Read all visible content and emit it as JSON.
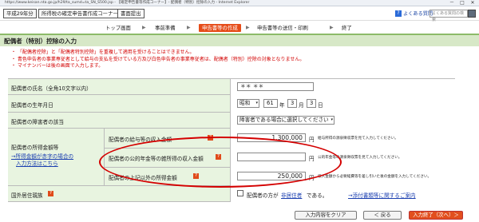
{
  "browser": {
    "title_text": "https://www.keisan.nta.go.jp/h29/ta_sumd=ta_SN_S500.jsp - 【確定申告書等作成コーナー】- 配偶者（特別）控除の入力 - Internet Explorer",
    "minimize": "－",
    "maximize": "□",
    "close": "✕"
  },
  "header": {
    "year_badge": "平成29年分",
    "corner_name": "所得税の確定申告書作成コーナー",
    "submit_label": "書面提出",
    "faq_label": "よくある質問",
    "search_placeholder": "よくある質問の検索"
  },
  "steps": [
    {
      "label": "トップ画面"
    },
    {
      "label": "事前準備"
    },
    {
      "label": "申告書等の作成"
    },
    {
      "label": "申告書等の送信・印刷"
    },
    {
      "label": "終了"
    }
  ],
  "section_title": "配偶者（特別）控除の入力",
  "cautions": [
    "・ 「配偶者控除」と「配偶者特別控除」を重複して適用を受けることはできません。",
    "・ 青色申告者の事業専従者として給与の支払を受けている方及び白色申告者の事業専従者は、配偶者（特別）控除の対象となりません。",
    "・ マイナンバーは後の画面で入力します。"
  ],
  "form": {
    "name_label": "配偶者の氏名（全角10文字以内）",
    "name_value": "＊＊ ＊＊",
    "birth_label": "配偶者の生年月日",
    "era_value": "昭和",
    "year_value": "61",
    "year_unit": "年",
    "month_value": "3",
    "month_unit": "月",
    "day_value": "3",
    "day_unit": "日",
    "disability_label": "配偶者の障害者の該当",
    "disability_value": "障害者である場合に選択してください",
    "income_group_label_1": "配偶者の所得金額等",
    "income_group_link_1": "→所得金額が赤字の場合の",
    "income_group_link_2": "入力方法はこちら",
    "salary_label": "配偶者の給与等の収入金額",
    "salary_value": "1,300,000",
    "salary_unit": "円",
    "salary_note": "給与所得の源泉徴収票を見て入力してください。",
    "pension_label": "配偶者の公的年金等の雑所得の収入金額",
    "pension_value": "",
    "pension_unit": "円",
    "pension_note": "公的年金等の源泉徴収票を見て入力してください。",
    "other_label": "配偶者の上記以外の所得金額",
    "other_value": "250,000",
    "other_unit": "円",
    "other_note": "収入金額から必要経費等を差し引いた後の金額を入力してください。",
    "resident_label": "国外居住親族",
    "resident_text_1": "配偶者の方が",
    "resident_link": "非居住者",
    "resident_text_2": "である。",
    "attach_link": "→添付書類等に関するご案内"
  },
  "buttons": {
    "clear": "入力内容をクリア",
    "back": "＜ 戻る",
    "next": "入力終了（次へ）＞"
  },
  "colors": {
    "current_step": "#e64c19",
    "section_band": "#d7e8c7",
    "label_cell": "#e8f4e0",
    "next_button": "#e24f1e",
    "annotation_oval": "#d40000"
  }
}
